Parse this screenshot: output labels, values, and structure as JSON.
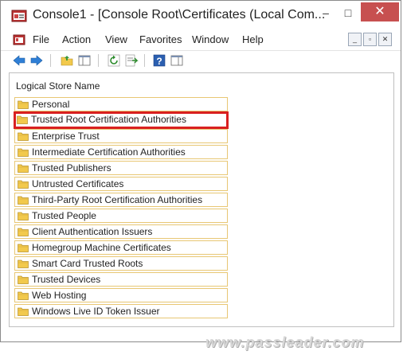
{
  "window": {
    "title": "Console1 - [Console Root\\Certificates (Local Com...",
    "min_glyph": "–",
    "max_glyph": "□",
    "close_glyph": "✕"
  },
  "menu": {
    "items": [
      "File",
      "Action",
      "View",
      "Favorites",
      "Window",
      "Help"
    ]
  },
  "mdi": {
    "min_glyph": "_",
    "restore_glyph": "▫",
    "close_glyph": "✕"
  },
  "pane": {
    "column_header": "Logical Store Name",
    "stores": [
      {
        "label": "Personal",
        "selected": false
      },
      {
        "label": "Trusted Root Certification Authorities",
        "selected": true
      },
      {
        "label": "Enterprise Trust",
        "selected": false
      },
      {
        "label": "Intermediate Certification Authorities",
        "selected": false
      },
      {
        "label": "Trusted Publishers",
        "selected": false
      },
      {
        "label": "Untrusted Certificates",
        "selected": false
      },
      {
        "label": "Third-Party Root Certification Authorities",
        "selected": false
      },
      {
        "label": "Trusted People",
        "selected": false
      },
      {
        "label": "Client Authentication Issuers",
        "selected": false
      },
      {
        "label": "Homegroup Machine Certificates",
        "selected": false
      },
      {
        "label": "Smart Card Trusted Roots",
        "selected": false
      },
      {
        "label": "Trusted Devices",
        "selected": false
      },
      {
        "label": "Web Hosting",
        "selected": false
      },
      {
        "label": "Windows Live ID Token Issuer",
        "selected": false
      }
    ]
  },
  "watermark": "www.passleader.com",
  "colors": {
    "highlight_border": "#d92020",
    "row_border": "#e8c774",
    "folder": "#f2c94c",
    "close_button": "#c75050"
  }
}
